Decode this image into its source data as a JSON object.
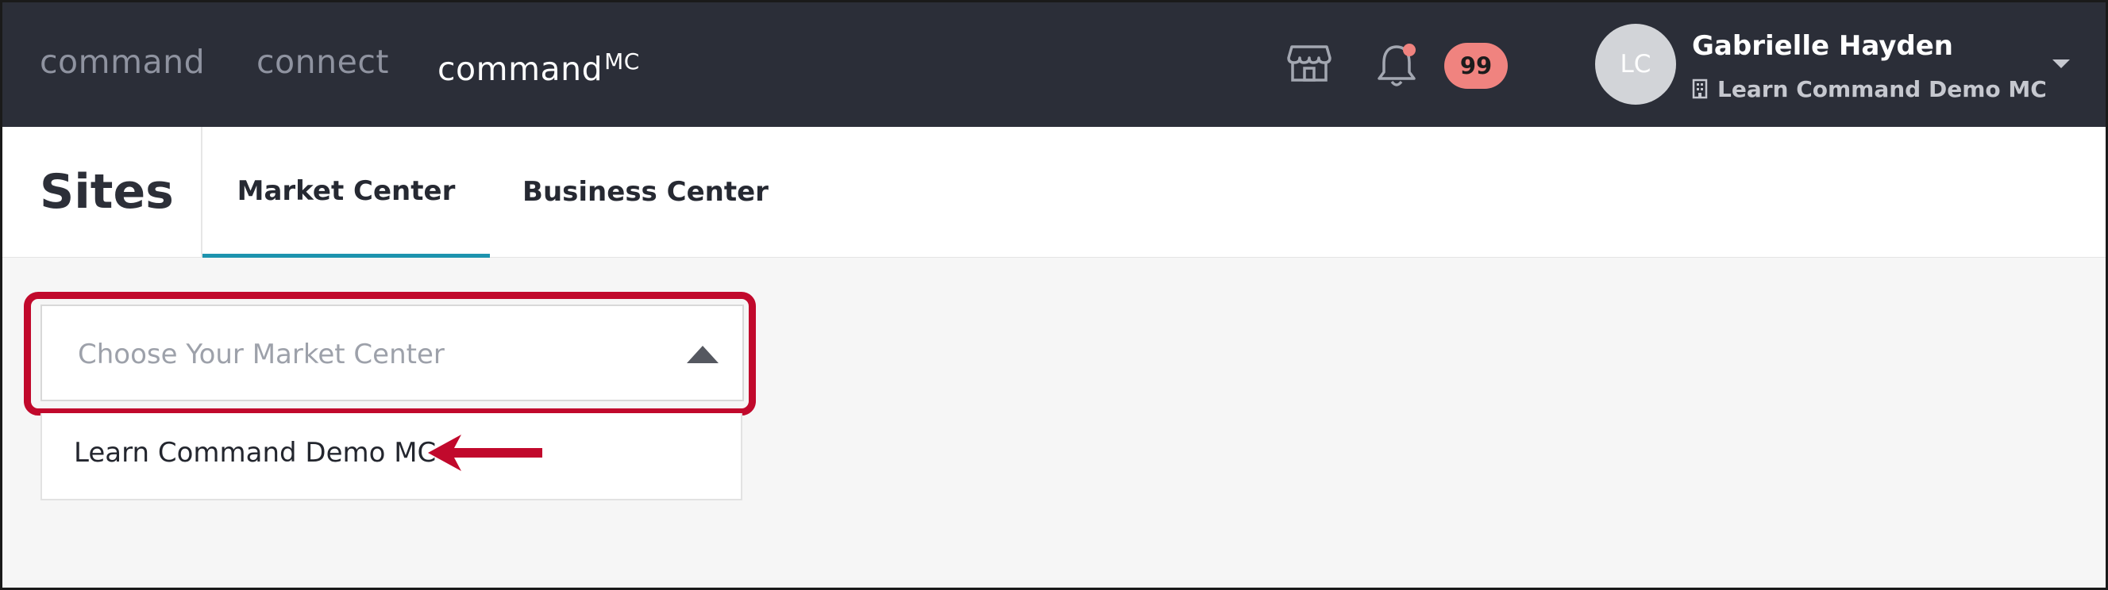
{
  "topnav": {
    "links": [
      "command",
      "connect",
      "command"
    ],
    "active_superscript": "MC",
    "notification_count": "99",
    "user": {
      "initials": "LC",
      "name": "Gabrielle Hayden",
      "org": "Learn Command Demo MC"
    }
  },
  "header": {
    "title": "Sites",
    "tabs": [
      {
        "label": "Market Center",
        "active": true
      },
      {
        "label": "Business Center",
        "active": false
      }
    ]
  },
  "market_select": {
    "placeholder": "Choose Your Market Center",
    "options": [
      "Learn Command Demo MC"
    ]
  },
  "colors": {
    "nav_bg": "#2b2e38",
    "tab_accent": "#1d93ae",
    "badge_bg": "#f0837f",
    "annotation_red": "#c1092c"
  }
}
